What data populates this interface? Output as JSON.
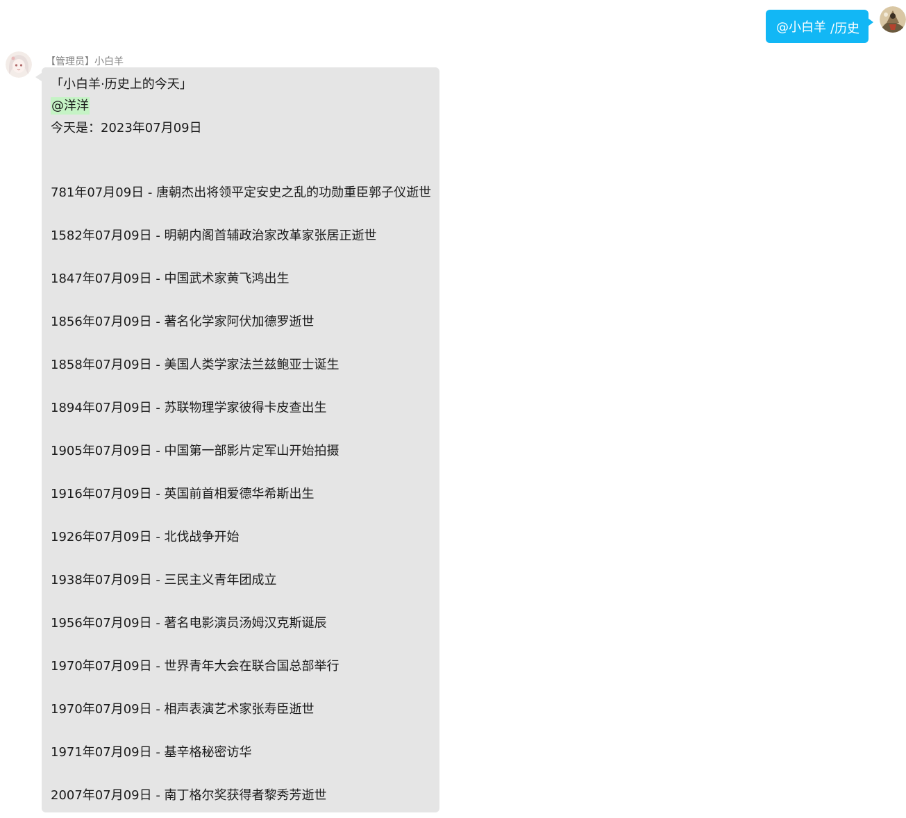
{
  "outgoing": {
    "mention": "@小白羊",
    "command": "/历史"
  },
  "incoming": {
    "sender": "【管理员】小白羊",
    "title": "「小白羊·历史上的今天」",
    "mention": "@洋洋",
    "today": "今天是：2023年07月09日",
    "events": [
      "781年07月09日 - 唐朝杰出将领平定安史之乱的功勋重臣郭子仪逝世",
      "1582年07月09日 - 明朝内阁首辅政治家改革家张居正逝世",
      "1847年07月09日 - 中国武术家黄飞鸿出生",
      "1856年07月09日 - 著名化学家阿伏加德罗逝世",
      "1858年07月09日 - 美国人类学家法兰兹鲍亚士诞生",
      "1894年07月09日 - 苏联物理学家彼得卡皮查出生",
      "1905年07月09日 - 中国第一部影片定军山开始拍摄",
      "1916年07月09日 - 英国前首相爱德华希斯出生",
      "1926年07月09日 - 北伐战争开始",
      "1938年07月09日 - 三民主义青年团成立",
      "1956年07月09日 - 著名电影演员汤姆汉克斯诞辰",
      "1970年07月09日 - 世界青年大会在联合国总部举行",
      "1970年07月09日 - 相声表演艺术家张寿臣逝世",
      "1971年07月09日 - 基辛格秘密访华",
      "2007年07月09日 - 南丁格尔奖获得者黎秀芳逝世"
    ]
  }
}
